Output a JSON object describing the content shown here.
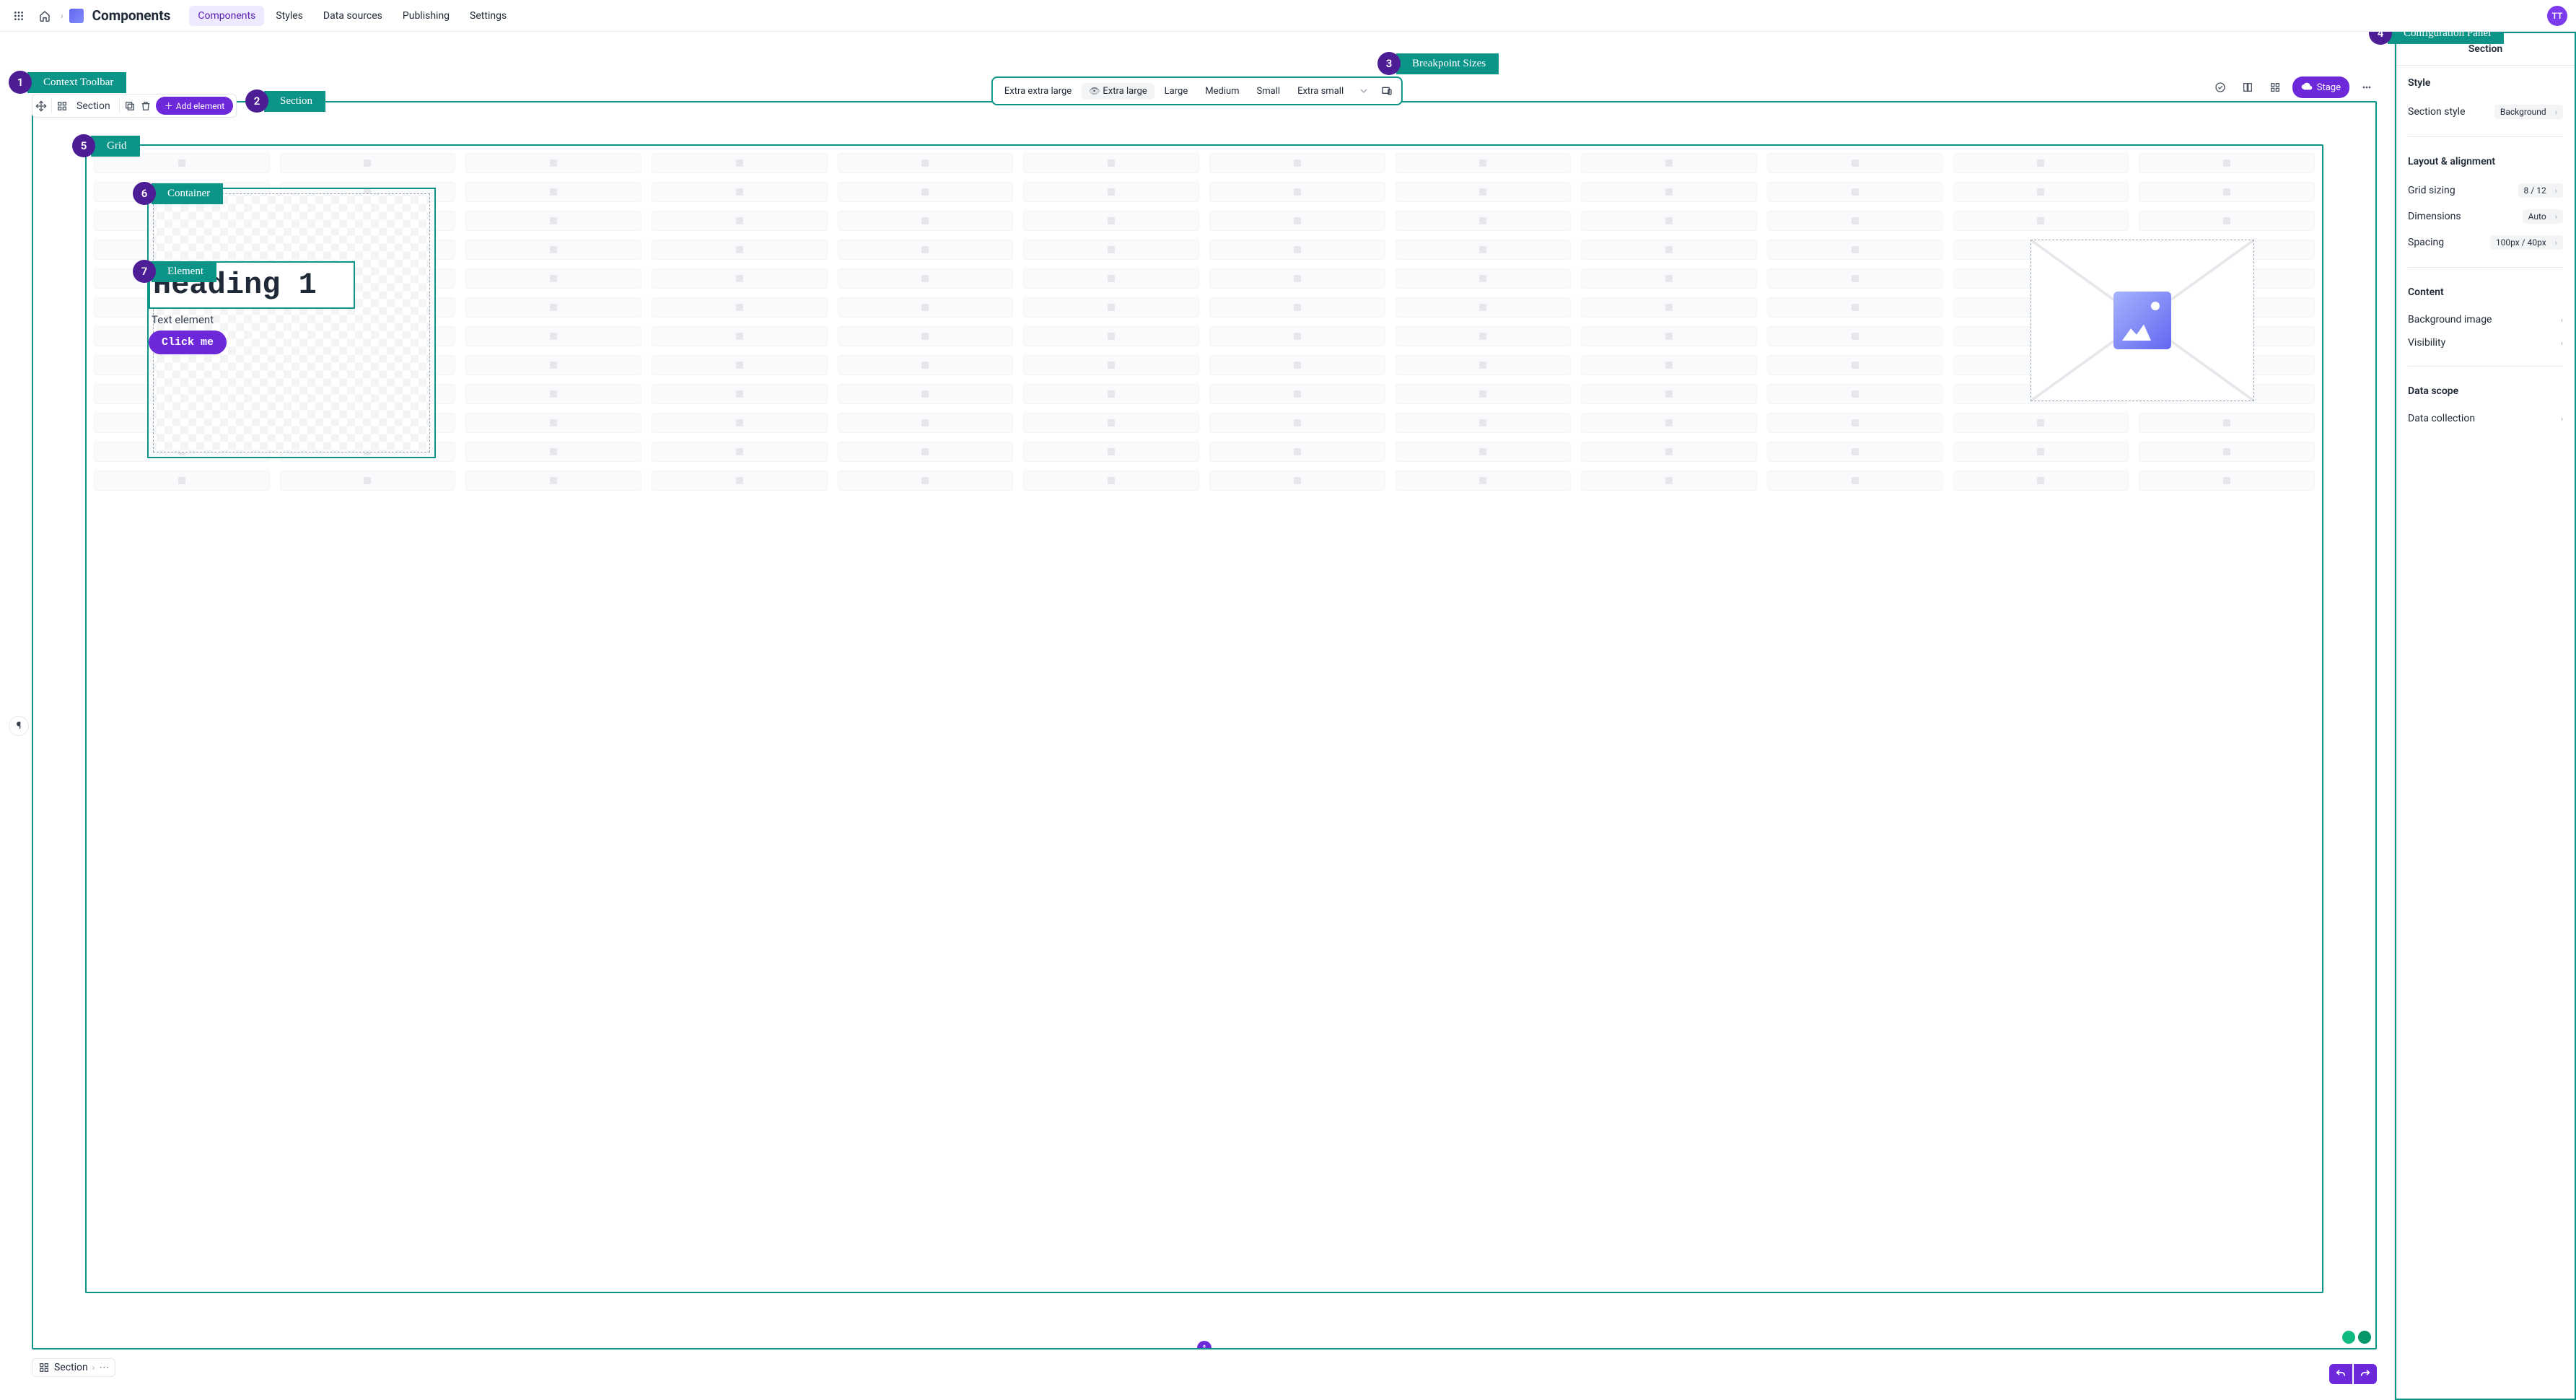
{
  "topbar": {
    "title": "Components",
    "tabs": [
      "Components",
      "Styles",
      "Data sources",
      "Publishing",
      "Settings"
    ],
    "active_tab_index": 0,
    "avatar": "TT"
  },
  "callouts": {
    "c1": {
      "num": "1",
      "label": "Context Toolbar"
    },
    "c2": {
      "num": "2",
      "label": "Section"
    },
    "c3": {
      "num": "3",
      "label": "Breakpoint Sizes"
    },
    "c4": {
      "num": "4",
      "label": "Configuration Panel"
    },
    "c5": {
      "num": "5",
      "label": "Grid"
    },
    "c6": {
      "num": "6",
      "label": "Container"
    },
    "c7": {
      "num": "7",
      "label": "Element"
    }
  },
  "breakpoints": {
    "items": [
      "Extra extra large",
      "Extra large",
      "Large",
      "Medium",
      "Small",
      "Extra small"
    ],
    "active_index": 1
  },
  "toolrow": {
    "stage_label": "Stage"
  },
  "context_toolbar": {
    "name": "Section",
    "add_label": "Add element"
  },
  "canvas": {
    "heading": "Heading 1",
    "text": "Text element",
    "button": "Click me"
  },
  "breadcrumb": {
    "item": "Section"
  },
  "right_panel": {
    "title": "Section",
    "style": {
      "heading": "Style",
      "section_style": {
        "label": "Section style",
        "value": "Background"
      }
    },
    "layout": {
      "heading": "Layout & alignment",
      "grid_sizing": {
        "label": "Grid sizing",
        "value": "8 / 12"
      },
      "dimensions": {
        "label": "Dimensions",
        "value": "Auto"
      },
      "spacing": {
        "label": "Spacing",
        "value": "100px / 40px"
      }
    },
    "content": {
      "heading": "Content",
      "bg_image": {
        "label": "Background image"
      },
      "visibility": {
        "label": "Visibility"
      }
    },
    "data_scope": {
      "heading": "Data scope",
      "data_collection": {
        "label": "Data collection"
      }
    }
  }
}
